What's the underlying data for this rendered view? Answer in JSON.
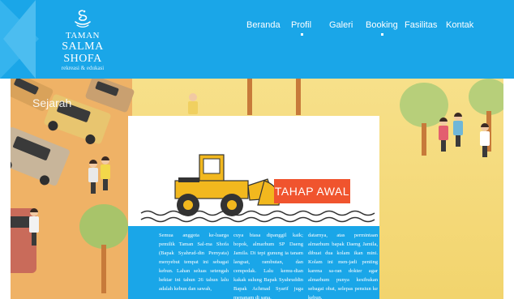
{
  "brand": {
    "line1": "TAMAN",
    "line2": "SALMA SHOFA",
    "line3": "rekreasi & edukasi",
    "logo_icon": "swirl-logo-icon"
  },
  "nav": {
    "items": [
      {
        "label": "Beranda",
        "active_dot": false
      },
      {
        "label": "Profil",
        "active_dot": true
      },
      {
        "label": "Galeri",
        "active_dot": false
      },
      {
        "label": "Booking",
        "active_dot": true
      },
      {
        "label": "Fasilitas",
        "active_dot": false
      },
      {
        "label": "Kontak",
        "active_dot": false
      }
    ]
  },
  "hero": {
    "section_title": "Sejarah"
  },
  "card": {
    "badge": "TAHAP AWAL",
    "illustration_icon": "bulldozer-icon",
    "columns": [
      "Semua anggota ke-luarga pemilik Taman Sal-ma Shofa (Bapak Syahrud-din Pernyata) menyebut tempat ini sebagai kebun. Lahan seluas setengah hektar ini tahun 26 tahun lalu adalah kebun dan sawah,",
      "cuya biasa dipanggil kaik; bopok, almarhum SP Daeng Jamila. Di tepi gunung ia tanam langsat, rambutan, dan cempedak. Lalu kemu-dian kakak sulung Bapak Syahruddin Bapak Achmad Syarif juga menanam di sana.",
      "datarnya, atas permintaan almarhum bapak Daeng Jamila, dibuat dua kolam ikan mini. Kolam ini men-jadi penting karena sa-ran dokter agar almarhum punya kesibukan sebagai obat, selepas pensiun ke kebun."
    ]
  },
  "colors": {
    "header_bg": "#1aa6e8",
    "badge_bg": "#f0542e",
    "hero_bg": "#f5db79",
    "text_panel_bg": "#1aa6e8"
  }
}
